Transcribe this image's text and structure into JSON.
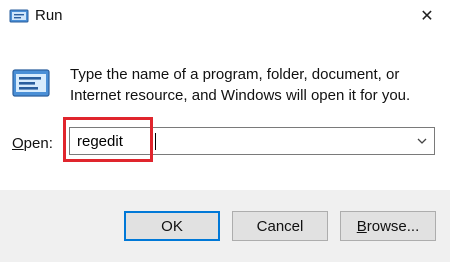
{
  "window": {
    "title": "Run",
    "close_glyph": "✕",
    "icon": "run-icon"
  },
  "description": "Type the name of a program, folder, document, or Internet resource, and Windows will open it for you.",
  "open_field": {
    "label_mnemonic": "O",
    "label_rest": "pen:",
    "value": "regedit",
    "highlight_color": "#e0252d"
  },
  "buttons": {
    "ok": "OK",
    "cancel": "Cancel",
    "browse_mnemonic": "B",
    "browse_rest": "rowse..."
  },
  "colors": {
    "accent": "#0078d7",
    "footer_bg": "#f0f0f0"
  }
}
